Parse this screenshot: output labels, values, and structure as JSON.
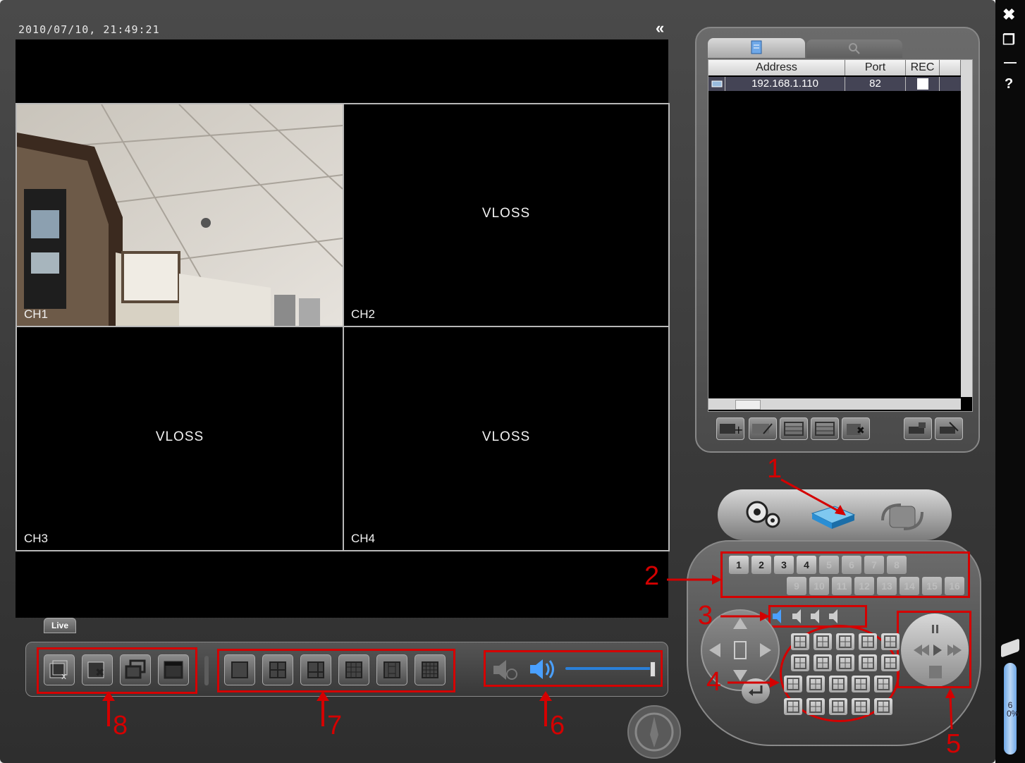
{
  "timestamp": "2010/07/10, 21:49:21",
  "collapse_glyph": "«",
  "channels": [
    {
      "label": "CH1",
      "status": ""
    },
    {
      "label": "CH2",
      "status": "VLOSS"
    },
    {
      "label": "CH3",
      "status": "VLOSS"
    },
    {
      "label": "CH4",
      "status": "VLOSS"
    }
  ],
  "live_tab": "Live",
  "device_list": {
    "columns": [
      "Address",
      "Port",
      "REC"
    ],
    "rows": [
      {
        "address": "192.168.1.110",
        "port": "82",
        "rec": ""
      }
    ]
  },
  "channel_buttons": [
    "1",
    "2",
    "3",
    "4",
    "5",
    "6",
    "7",
    "8",
    "9",
    "10",
    "11",
    "12",
    "13",
    "14",
    "15",
    "16"
  ],
  "annotations": [
    "1",
    "2",
    "3",
    "4",
    "5",
    "6",
    "7",
    "8"
  ],
  "volume_level": 1.0,
  "scroll_percent": "60%",
  "window_controls": {
    "close": "✖",
    "restore": "❐",
    "minimize": "—",
    "help": "?"
  },
  "accent_red": "#d40000"
}
